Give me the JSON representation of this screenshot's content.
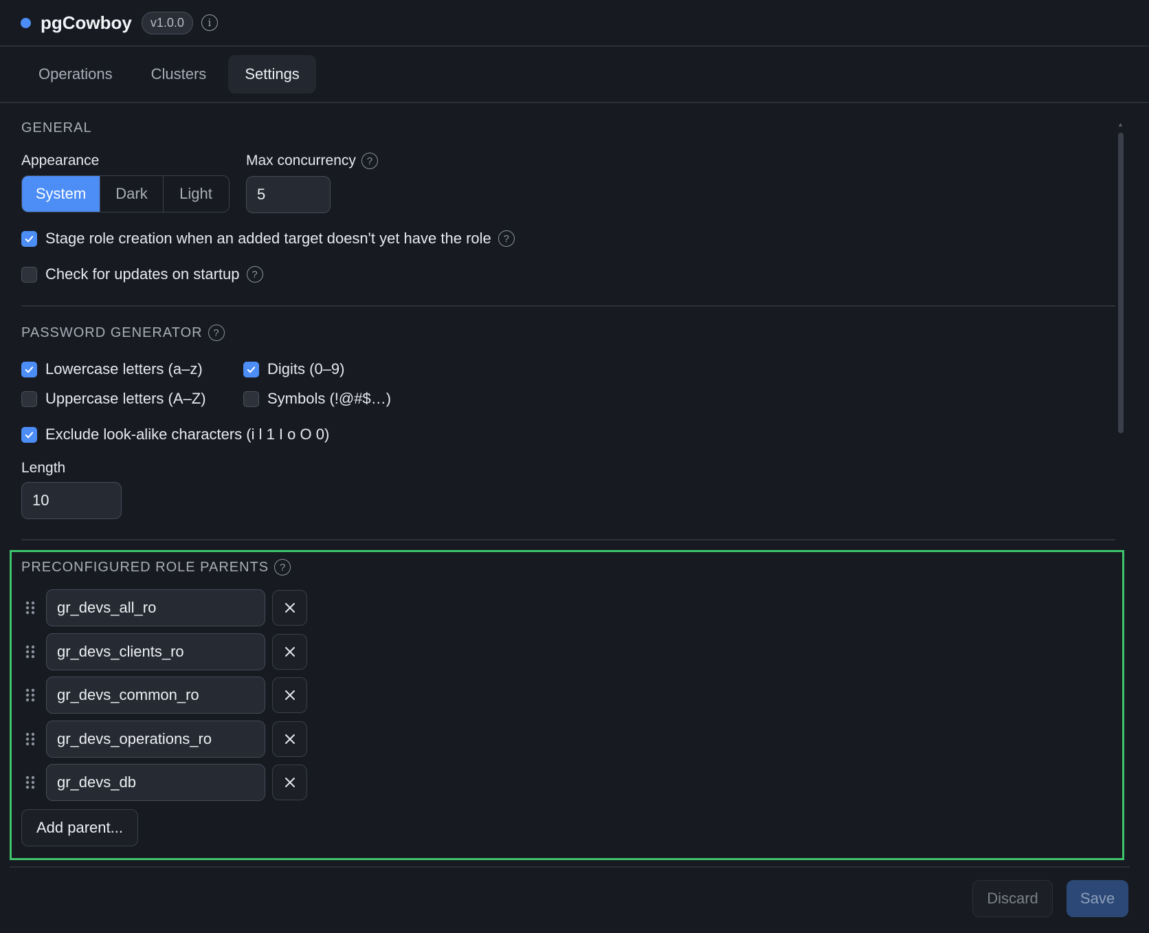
{
  "header": {
    "app_name": "pgCowboy",
    "version": "v1.0.0",
    "status_color": "#4c8df6"
  },
  "tabs": [
    {
      "label": "Operations",
      "active": false
    },
    {
      "label": "Clusters",
      "active": false
    },
    {
      "label": "Settings",
      "active": true
    }
  ],
  "general": {
    "heading": "GENERAL",
    "appearance_label": "Appearance",
    "appearance_options": [
      "System",
      "Dark",
      "Light"
    ],
    "appearance_selected": "System",
    "max_concurrency_label": "Max concurrency",
    "max_concurrency_value": "5",
    "stage_role_label": "Stage role creation when an added target doesn't yet have the role",
    "stage_role_checked": true,
    "check_updates_label": "Check for updates on startup",
    "check_updates_checked": false
  },
  "password_generator": {
    "heading": "PASSWORD GENERATOR",
    "lowercase_label": "Lowercase letters (a–z)",
    "lowercase_checked": true,
    "digits_label": "Digits (0–9)",
    "digits_checked": true,
    "uppercase_label": "Uppercase letters (A–Z)",
    "uppercase_checked": false,
    "symbols_label": "Symbols (!@#$…)",
    "symbols_checked": false,
    "exclude_label": "Exclude look-alike characters (i l 1 I o O 0)",
    "exclude_checked": true,
    "length_label": "Length",
    "length_value": "10"
  },
  "role_parents": {
    "heading": "PRECONFIGURED ROLE PARENTS",
    "items": [
      "gr_devs_all_ro",
      "gr_devs_clients_ro",
      "gr_devs_common_ro",
      "gr_devs_operations_ro",
      "gr_devs_db"
    ],
    "add_label": "Add parent..."
  },
  "footer": {
    "discard_label": "Discard",
    "save_label": "Save"
  },
  "colors": {
    "accent": "#4c8df6",
    "highlight": "#3ec46d",
    "background": "#171a21"
  }
}
